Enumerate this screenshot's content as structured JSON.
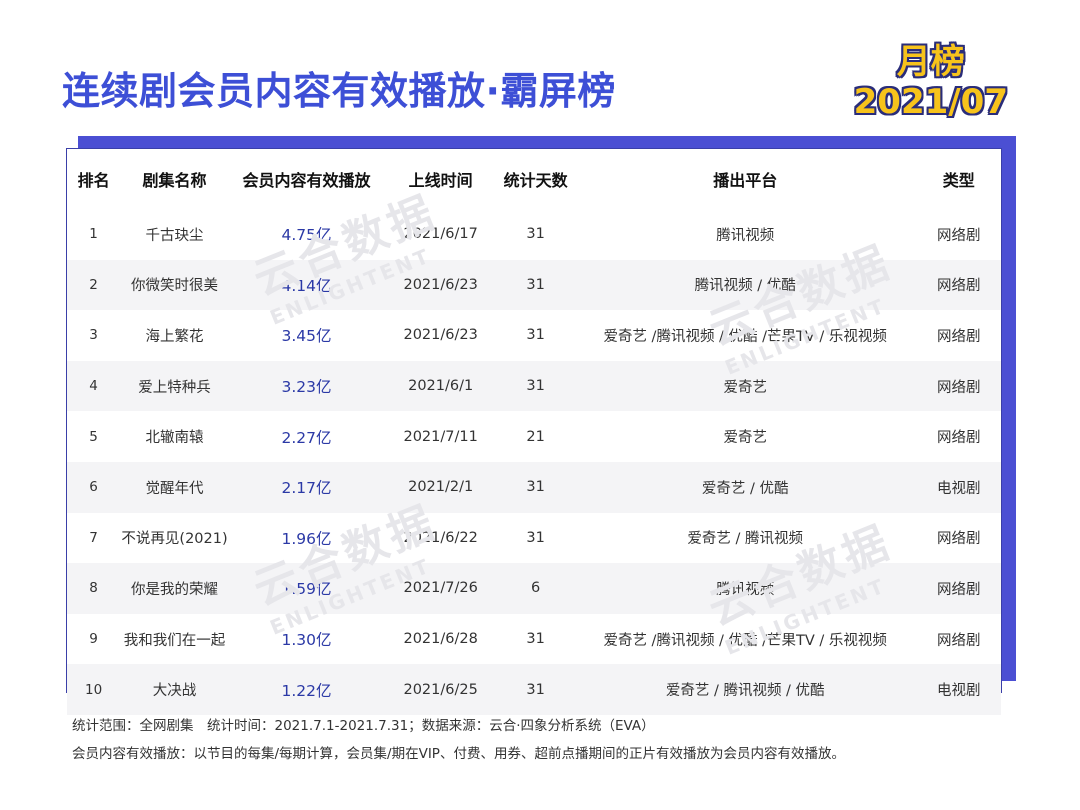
{
  "title": "连续剧会员内容有效播放·霸屏榜",
  "badge": {
    "line1": "月榜",
    "line2": "2021/07"
  },
  "table": {
    "headers": [
      "排名",
      "剧集名称",
      "会员内容有效播放",
      "上线时间",
      "统计天数",
      "播出平台",
      "类型"
    ],
    "rows": [
      [
        "1",
        "千古玦尘",
        "4.75亿",
        "2021/6/17",
        "31",
        "腾讯视频",
        "网络剧"
      ],
      [
        "2",
        "你微笑时很美",
        "4.14亿",
        "2021/6/23",
        "31",
        "腾讯视频 / 优酷",
        "网络剧"
      ],
      [
        "3",
        "海上繁花",
        "3.45亿",
        "2021/6/23",
        "31",
        "爱奇艺 /腾讯视频 / 优酷 /芒果TV / 乐视视频",
        "网络剧"
      ],
      [
        "4",
        "爱上特种兵",
        "3.23亿",
        "2021/6/1",
        "31",
        "爱奇艺",
        "网络剧"
      ],
      [
        "5",
        "北辙南辕",
        "2.27亿",
        "2021/7/11",
        "21",
        "爱奇艺",
        "网络剧"
      ],
      [
        "6",
        "觉醒年代",
        "2.17亿",
        "2021/2/1",
        "31",
        "爱奇艺 / 优酷",
        "电视剧"
      ],
      [
        "7",
        "不说再见(2021)",
        "1.96亿",
        "2021/6/22",
        "31",
        "爱奇艺 / 腾讯视频",
        "网络剧"
      ],
      [
        "8",
        "你是我的荣耀",
        "1.59亿",
        "2021/7/26",
        "6",
        "腾讯视频",
        "网络剧"
      ],
      [
        "9",
        "我和我们在一起",
        "1.30亿",
        "2021/6/28",
        "31",
        "爱奇艺 /腾讯视频 / 优酷 /芒果TV / 乐视视频",
        "网络剧"
      ],
      [
        "10",
        "大决战",
        "1.22亿",
        "2021/6/25",
        "31",
        "爱奇艺 / 腾讯视频 / 优酷",
        "电视剧"
      ]
    ]
  },
  "watermark": {
    "cn": "云合数据",
    "en": "ENLIGHTENT"
  },
  "footer": {
    "line1": "统计范围：全网剧集　统计时间：2021.7.1-2021.7.31；数据来源：云合·四象分析系统（EVA）",
    "line2": "会员内容有效播放：以节目的每集/每期计算，会员集/期在VIP、付费、用券、超前点播期间的正片有效播放为会员内容有效播放。"
  },
  "colors": {
    "title": "#3d4fd6",
    "accent": "#4b4fd3",
    "badge": "#f7c31b",
    "value": "#2b39a6"
  }
}
